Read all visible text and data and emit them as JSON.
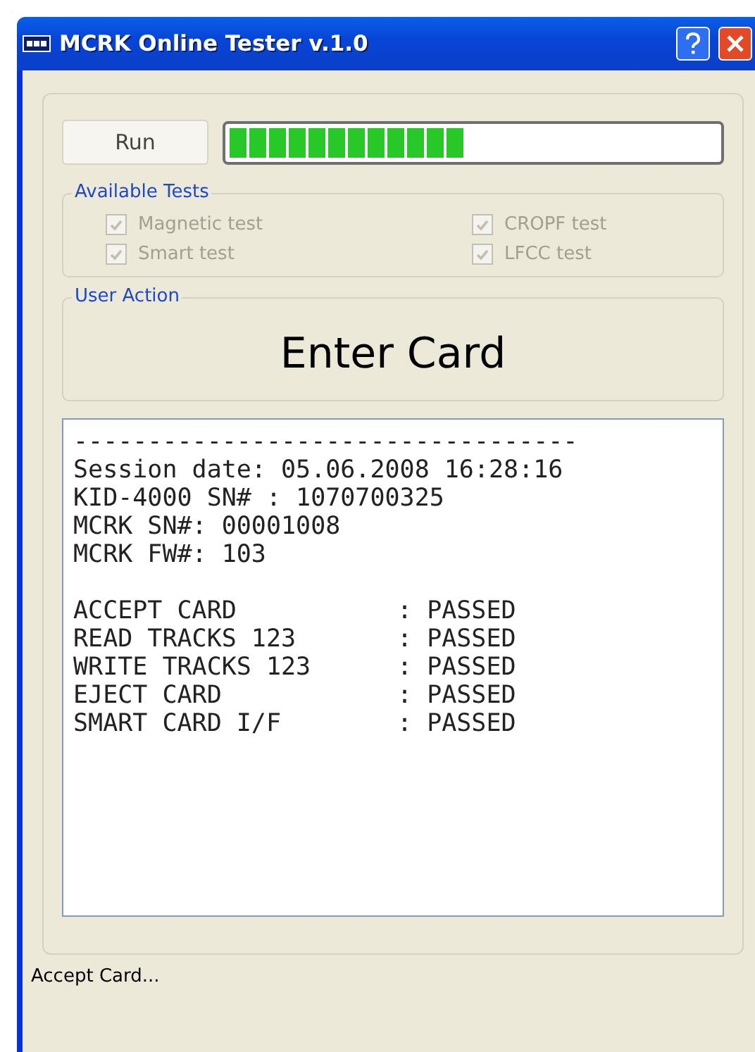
{
  "window": {
    "title": "MCRK Online Tester v.1.0"
  },
  "run_button": {
    "label": "Run"
  },
  "progress": {
    "level": 0.51
  },
  "available_tests": {
    "title": "Available Tests",
    "items": [
      {
        "label": "Magnetic test",
        "checked": true,
        "disabled": true
      },
      {
        "label": "CROPF test",
        "checked": true,
        "disabled": true
      },
      {
        "label": "Smart test",
        "checked": true,
        "disabled": true
      },
      {
        "label": "LFCC test",
        "checked": true,
        "disabled": true
      }
    ]
  },
  "user_action": {
    "title": "User Action",
    "message": "Enter Card"
  },
  "log": {
    "separator": "----------------------------------",
    "header_lines": [
      "Session date: 05.06.2008 16:28:16",
      "KID-4000 SN# : 1070700325",
      "MCRK SN#: 00001008",
      "MCRK FW#: 103"
    ],
    "results": [
      {
        "test": "ACCEPT CARD",
        "result": ": PASSED"
      },
      {
        "test": "READ TRACKS 123",
        "result": ": PASSED"
      },
      {
        "test": "WRITE TRACKS 123",
        "result": ": PASSED"
      },
      {
        "test": "EJECT CARD",
        "result": ": PASSED"
      },
      {
        "test": "SMART CARD I/F",
        "result": ": PASSED"
      }
    ]
  },
  "status_bar": {
    "text": "Accept Card..."
  }
}
